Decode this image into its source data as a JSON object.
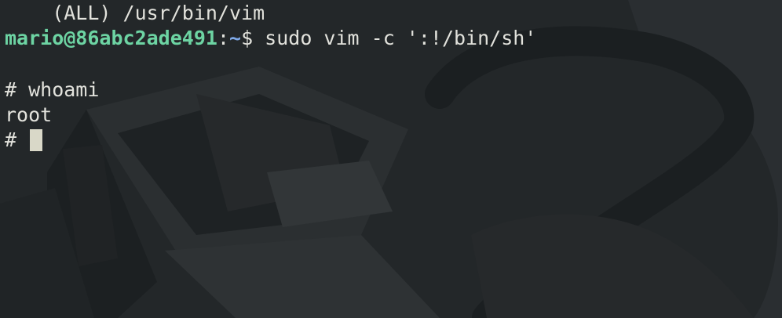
{
  "terminal": {
    "lines": {
      "sudo_entry": "    (ALL) /usr/bin/vim",
      "prompt_user_host": "mario@86abc2ade491",
      "prompt_colon": ":",
      "prompt_path": "~",
      "prompt_dollar": "$",
      "prompt_command": " sudo vim -c ':!/bin/sh'",
      "root_prompt_1": "# whoami",
      "output_root": "root",
      "root_prompt_2": "# "
    },
    "colors": {
      "background": "#232729",
      "foreground": "#e2e2dc",
      "user_host": "#6dd4a3",
      "path": "#7fa9e8",
      "cursor": "#d9d8c8"
    }
  }
}
